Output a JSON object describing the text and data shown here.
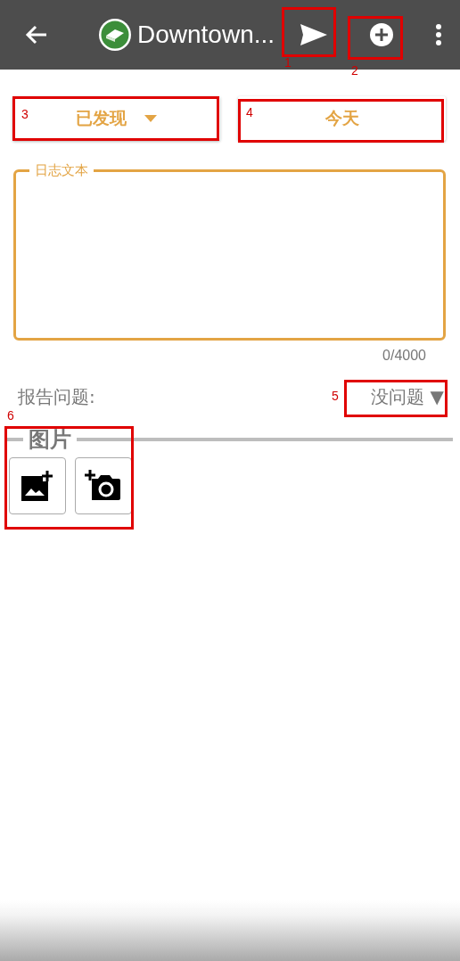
{
  "app_bar": {
    "title": "Downtown..."
  },
  "status_button": {
    "label": "已发现"
  },
  "date_button": {
    "label": "今天"
  },
  "log_field": {
    "label": "日志文本",
    "counter": "0/4000"
  },
  "report": {
    "label": "报告问题:",
    "value": "没问题",
    "caret": "▼"
  },
  "photos": {
    "title": "图片"
  },
  "annotations": [
    {
      "number": "1"
    },
    {
      "number": "2"
    },
    {
      "number": "3"
    },
    {
      "number": "4"
    },
    {
      "number": "5"
    },
    {
      "number": "6"
    }
  ]
}
